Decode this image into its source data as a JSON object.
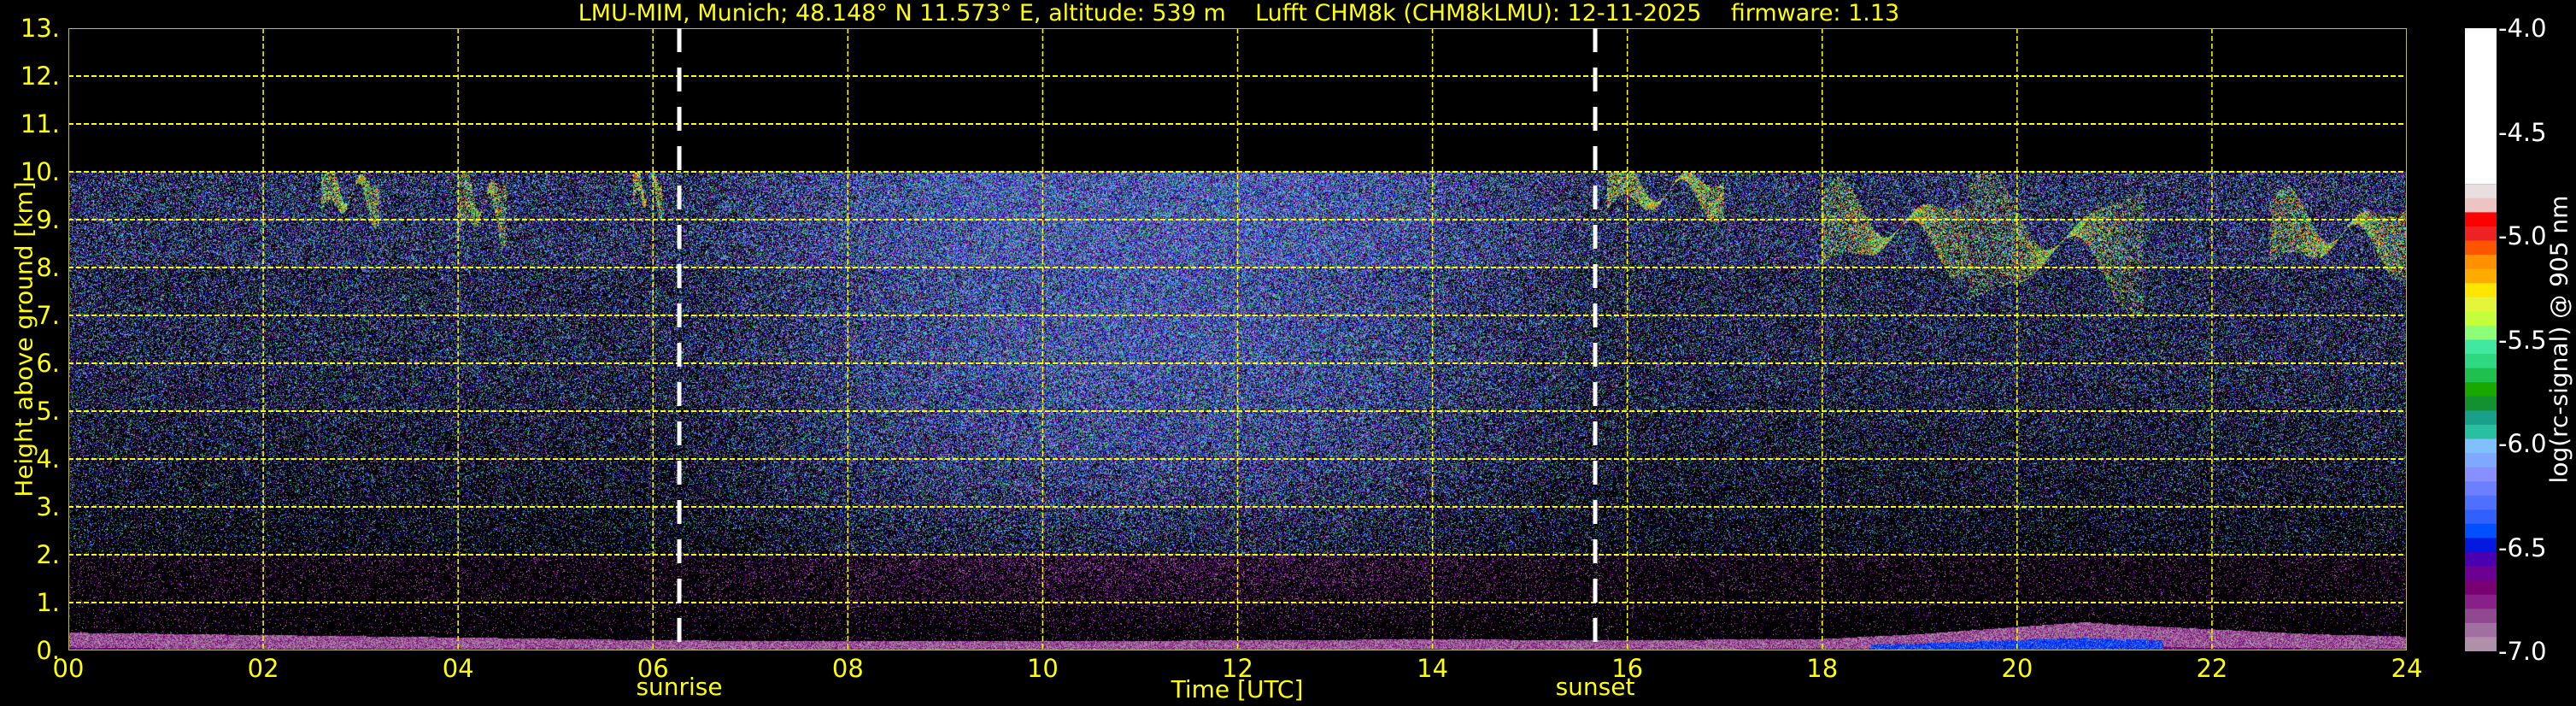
{
  "title": "LMU-MIM, Munich; 48.148° N 11.573° E, altitude: 539 m    Lufft CHM8k (CHM8kLMU): 12-11-2025    firmware: 1.13",
  "chart_data": {
    "type": "heatmap",
    "title": "LMU-MIM, Munich; 48.148° N 11.573° E, altitude: 539 m    Lufft CHM8k (CHM8kLMU): 12-11-2025    firmware: 1.13",
    "xlabel": "Time [UTC]",
    "ylabel": "Height above ground [km]",
    "xlim": [
      0,
      24
    ],
    "ylim": [
      0,
      13
    ],
    "xticks": [
      "00",
      "02",
      "04",
      "06",
      "08",
      "10",
      "12",
      "14",
      "16",
      "18",
      "20",
      "22",
      "24"
    ],
    "xtick_values": [
      0,
      2,
      4,
      6,
      8,
      10,
      12,
      14,
      16,
      18,
      20,
      22,
      24
    ],
    "yticks": [
      "0.",
      "1.",
      "2.",
      "3.",
      "4.",
      "5.",
      "6.",
      "7.",
      "8.",
      "9.",
      "10.",
      "11.",
      "12.",
      "13."
    ],
    "ytick_values": [
      0,
      1,
      2,
      3,
      4,
      5,
      6,
      7,
      8,
      9,
      10,
      11,
      12,
      13
    ],
    "grid": true,
    "signal_max_height_km": 10,
    "annotations": [
      {
        "label": "sunrise",
        "time_h": 6.27
      },
      {
        "label": "sunset",
        "time_h": 15.67
      }
    ],
    "boundary_layer": {
      "time_h": [
        0,
        2,
        4,
        6,
        8,
        10,
        12,
        14,
        16,
        18,
        19,
        20,
        20.7,
        21,
        22,
        23,
        24
      ],
      "top_km": [
        0.38,
        0.33,
        0.28,
        0.22,
        0.2,
        0.2,
        0.22,
        0.24,
        0.22,
        0.25,
        0.35,
        0.5,
        0.6,
        0.55,
        0.45,
        0.35,
        0.3
      ]
    },
    "cloud_layers": [
      {
        "time_h": [
          2.6,
          3.2
        ],
        "height_km": [
          9.1,
          10.0
        ]
      },
      {
        "time_h": [
          4.0,
          4.5
        ],
        "height_km": [
          8.7,
          10.0
        ]
      },
      {
        "time_h": [
          5.8,
          6.1
        ],
        "height_km": [
          9.3,
          10.0
        ]
      },
      {
        "time_h": [
          15.8,
          17.0
        ],
        "height_km": [
          9.2,
          10.0
        ]
      },
      {
        "time_h": [
          18.0,
          19.5
        ],
        "height_km": [
          8.0,
          9.6
        ]
      },
      {
        "time_h": [
          19.5,
          21.3
        ],
        "height_km": [
          7.2,
          9.8
        ]
      },
      {
        "time_h": [
          22.6,
          24.0
        ],
        "height_km": [
          8.0,
          9.4
        ]
      }
    ],
    "colorbar": {
      "label": "log(rc-signal) @ 905 nm",
      "range": [
        -7.0,
        -4.0
      ],
      "ticks": [
        "-4.0",
        "-4.5",
        "-5.0",
        "-5.5",
        "-6.0",
        "-6.5",
        "-7.0"
      ],
      "tick_values": [
        -4.0,
        -4.5,
        -5.0,
        -5.5,
        -6.0,
        -6.5,
        -7.0
      ],
      "colors": [
        "#ffffff",
        "#eadfdf",
        "#ecc4c4",
        "#ff0000",
        "#ee2222",
        "#ff5500",
        "#ff9000",
        "#ffab00",
        "#ffe600",
        "#e4f53c",
        "#c4ff3c",
        "#8cff78",
        "#40e8a0",
        "#2ed880",
        "#20c050",
        "#18a800",
        "#139030",
        "#18a088",
        "#28c0a0",
        "#80c0ff",
        "#80a8ff",
        "#8890ff",
        "#6c80ff",
        "#5070ff",
        "#3060ff",
        "#0050ff",
        "#0018e0",
        "#4800b0",
        "#6c0090",
        "#780070",
        "#882088",
        "#904890",
        "#a070a0",
        "#b090a8"
      ]
    }
  },
  "labels": {
    "sunrise": "sunrise",
    "sunset": "sunset"
  }
}
